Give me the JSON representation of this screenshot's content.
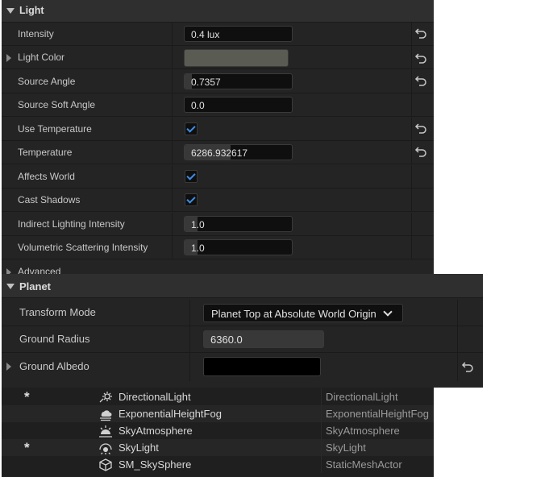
{
  "light": {
    "title": "Light",
    "rows": [
      {
        "label": "Intensity",
        "value": "0.4 lux"
      },
      {
        "label": "Light Color"
      },
      {
        "label": "Source Angle",
        "value": "0.7357"
      },
      {
        "label": "Source Soft Angle",
        "value": "0.0"
      },
      {
        "label": "Use Temperature"
      },
      {
        "label": "Temperature",
        "value": "6286.932617"
      },
      {
        "label": "Affects World"
      },
      {
        "label": "Cast Shadows"
      },
      {
        "label": "Indirect Lighting Intensity",
        "value": "1.0"
      },
      {
        "label": "Volumetric Scattering Intensity",
        "value": "1.0"
      }
    ],
    "advanced_label": "Advanced",
    "light_color_hex": "#5a5c53",
    "checks": {
      "use_temperature": true,
      "affects_world": true,
      "cast_shadows": true
    },
    "slider_fill": {
      "source_angle": 0.07,
      "temperature": 0.43,
      "indirect": 0.12,
      "volumetric": 0.12
    }
  },
  "planet": {
    "title": "Planet",
    "transform_mode_label": "Transform Mode",
    "transform_mode_value": "Planet Top at Absolute World Origin",
    "ground_radius_label": "Ground Radius",
    "ground_radius_value": "6360.0",
    "ground_albedo_label": "Ground Albedo",
    "ground_albedo_hex": "#000000"
  },
  "outliner": {
    "rows": [
      {
        "star": "*",
        "name": "DirectionalLight",
        "type": "DirectionalLight",
        "icon": "directional-light-icon"
      },
      {
        "star": "",
        "name": "ExponentialHeightFog",
        "type": "ExponentialHeightFog",
        "icon": "fog-icon"
      },
      {
        "star": "",
        "name": "SkyAtmosphere",
        "type": "SkyAtmosphere",
        "icon": "sky-atmosphere-icon"
      },
      {
        "star": "*",
        "name": "SkyLight",
        "type": "SkyLight",
        "icon": "sky-light-icon"
      },
      {
        "star": "",
        "name": "SM_SkySphere",
        "type": "StaticMeshActor",
        "icon": "static-mesh-icon"
      }
    ]
  }
}
